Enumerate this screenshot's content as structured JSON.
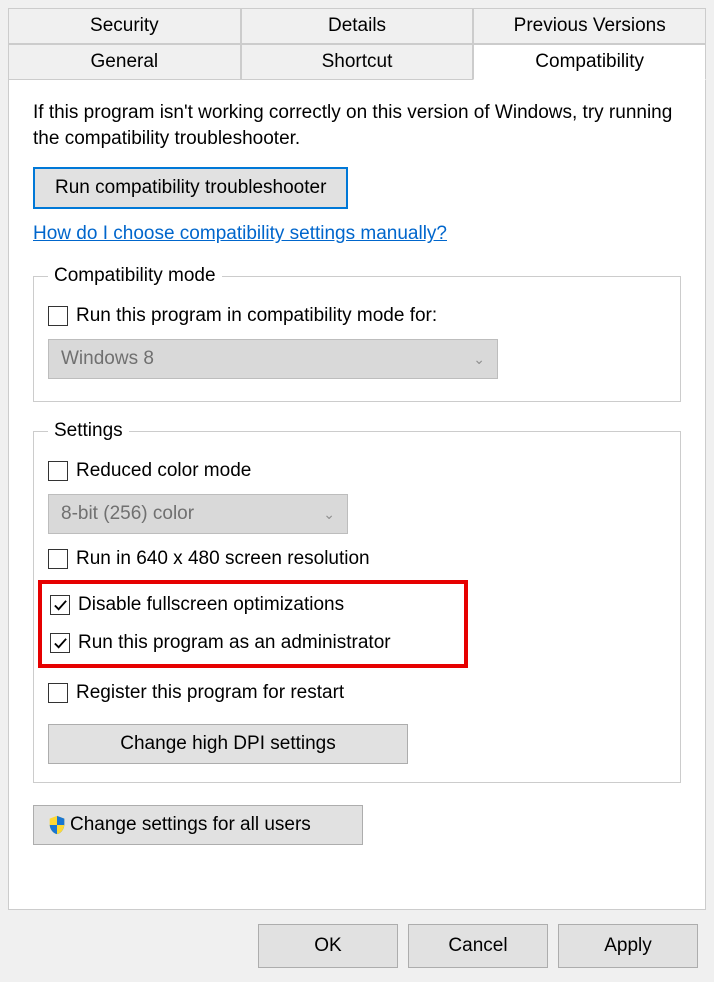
{
  "tabs": {
    "row1": [
      "Security",
      "Details",
      "Previous Versions"
    ],
    "row2": [
      "General",
      "Shortcut",
      "Compatibility"
    ],
    "active": "Compatibility"
  },
  "intro": "If this program isn't working correctly on this version of Windows, try running the compatibility troubleshooter.",
  "troubleshooter_btn": "Run compatibility troubleshooter",
  "help_link": "How do I choose compatibility settings manually?",
  "compat_mode": {
    "legend": "Compatibility mode",
    "checkbox_label": "Run this program in compatibility mode for:",
    "checked": false,
    "combo_value": "Windows 8"
  },
  "settings": {
    "legend": "Settings",
    "reduced_color": {
      "label": "Reduced color mode",
      "checked": false
    },
    "color_combo": "8-bit (256) color",
    "run_640": {
      "label": "Run in 640 x 480 screen resolution",
      "checked": false
    },
    "disable_fullscreen": {
      "label": "Disable fullscreen optimizations",
      "checked": true
    },
    "run_admin": {
      "label": "Run this program as an administrator",
      "checked": true
    },
    "register_restart": {
      "label": "Register this program for restart",
      "checked": false
    },
    "dpi_btn": "Change high DPI settings"
  },
  "all_users_btn": "Change settings for all users",
  "footer": {
    "ok": "OK",
    "cancel": "Cancel",
    "apply": "Apply"
  }
}
